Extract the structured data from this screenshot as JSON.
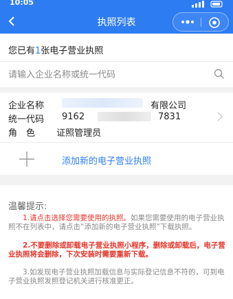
{
  "status_bar": {
    "time": "10:05"
  },
  "nav": {
    "title": "执照列表"
  },
  "colors": {
    "primary": "#2d7cf2",
    "warning": "#e3352a",
    "muted": "#888888"
  },
  "summary": {
    "prefix": "您已有",
    "count": "1",
    "suffix": "张电子营业执照"
  },
  "search": {
    "placeholder": "请输入企业名称或统一代码"
  },
  "license": {
    "name_label": "企业名称",
    "name_suffix": "有限公司",
    "code_label": "统一代码",
    "code_head": "9162",
    "code_tail": "7831",
    "role_label": "角　色",
    "role_value": "证照管理员"
  },
  "add": {
    "label": "添加新的电子营业执照"
  },
  "tips": {
    "title": "温馨提示:",
    "tip1_red": "1.请点击选择您需要使用的执照。",
    "tip1_rest": "如果您需要使用的电子营业执照不在列表中，请点击“添加新的电子营业执照”下载执照。",
    "tip2": "2.不要删除或卸载电子营业执照小程序，删除或卸载后，电子营业执照将会删除，下次安装时需要重新下载。",
    "tip3": "3.如发现电子营业执照加载信息与实际登记信息不符的，可到电子营业执照发照登记机关进行核准更正。"
  },
  "icons": [
    "signal-icon",
    "back-icon",
    "more-icon",
    "close-circle-icon",
    "search-icon",
    "chevron-right-icon",
    "plus-icon"
  ]
}
